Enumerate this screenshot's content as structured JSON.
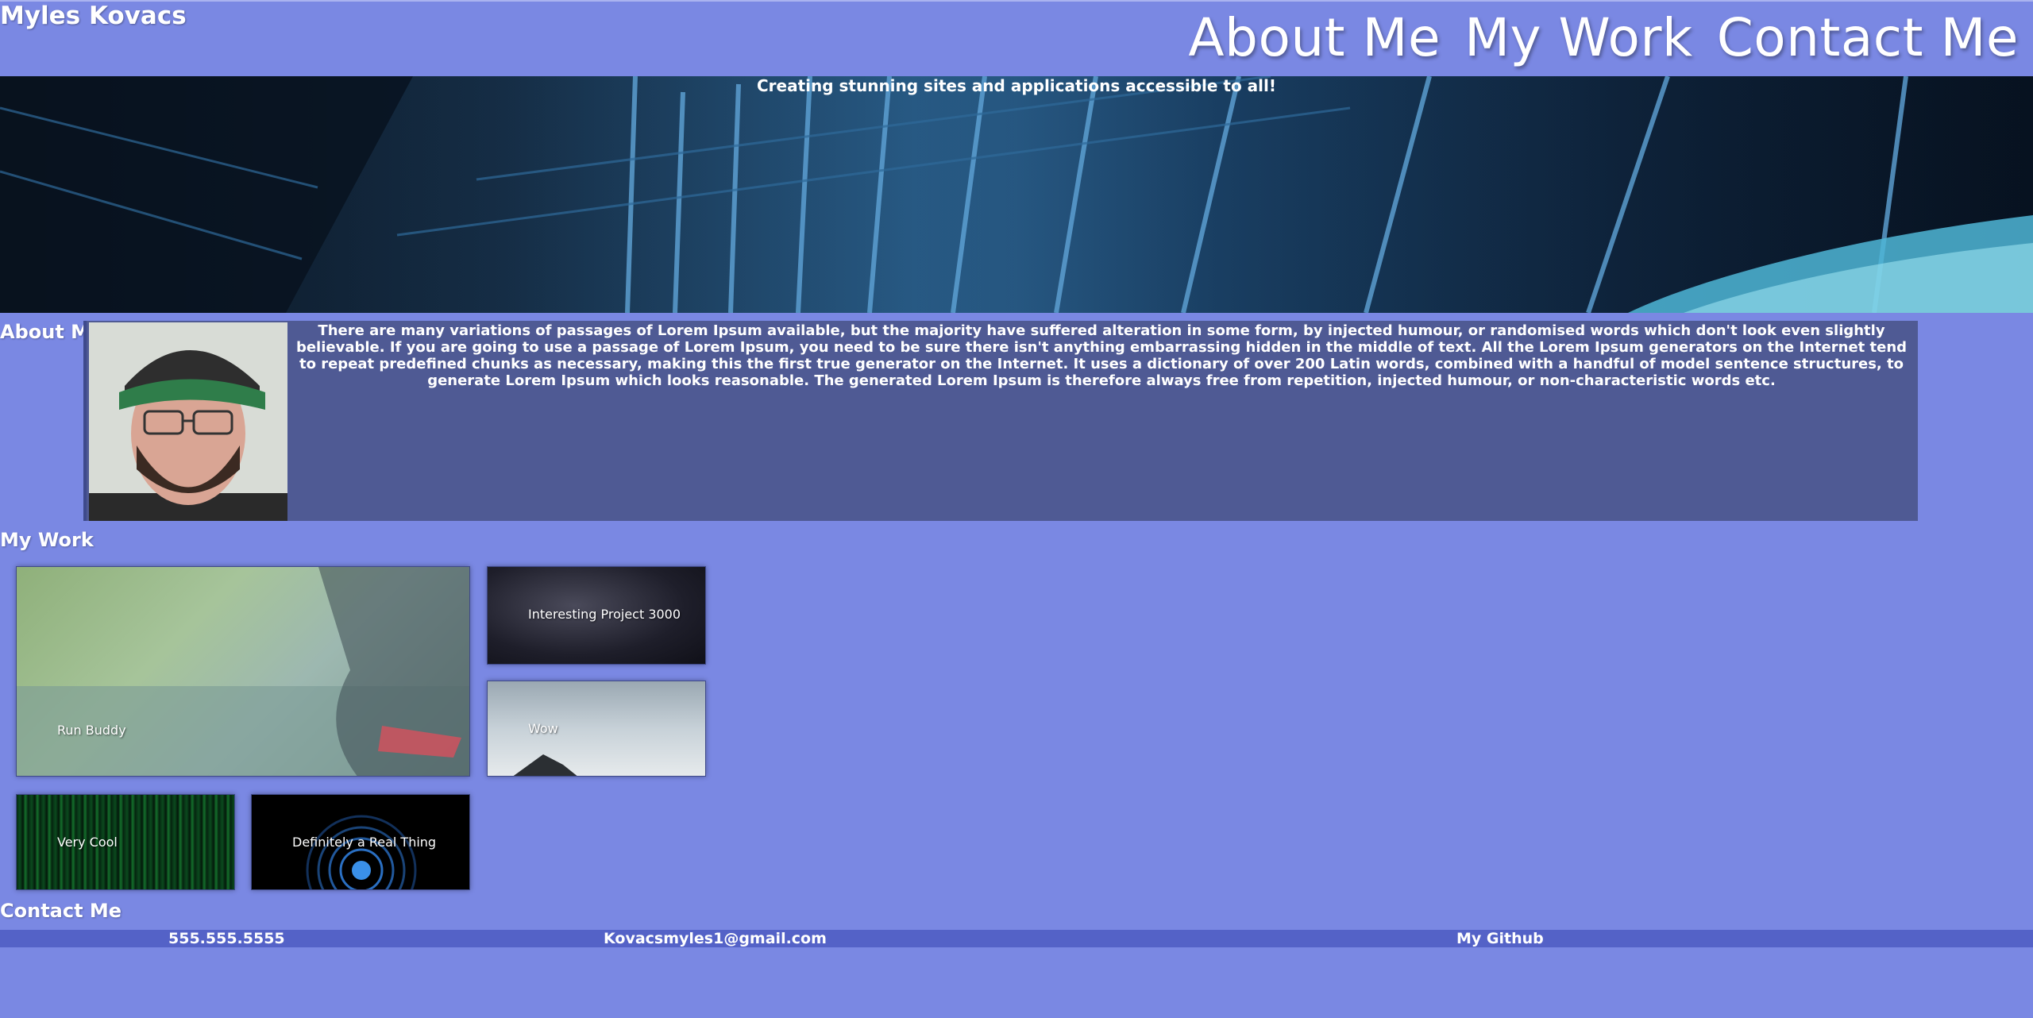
{
  "header": {
    "site_name": "Myles Kovacs",
    "nav": [
      "About Me",
      "My Work",
      "Contact Me"
    ]
  },
  "hero": {
    "tagline": "Creating stunning sites and applications accessible to all!"
  },
  "about": {
    "title": "About Me",
    "text": "There are many variations of passages of Lorem Ipsum available, but the majority have suffered alteration in some form, by injected humour, or randomised words which don't look even slightly believable. If you are going to use a passage of Lorem Ipsum, you need to be sure there isn't anything embarrassing hidden in the middle of text. All the Lorem Ipsum generators on the Internet tend to repeat predefined chunks as necessary, making this the first true generator on the Internet. It uses a dictionary of over 200 Latin words, combined with a handful of model sentence structures, to generate Lorem Ipsum which looks reasonable. The generated Lorem Ipsum is therefore always free from repetition, injected humour, or non-characteristic words etc."
  },
  "work": {
    "title": "My Work",
    "projects": [
      {
        "label": "Run Buddy"
      },
      {
        "label": "Interesting Project 3000"
      },
      {
        "label": "Wow"
      },
      {
        "label": "Very Cool"
      },
      {
        "label": "Definitely a Real Thing"
      }
    ]
  },
  "contact": {
    "title": "Contact Me",
    "phone": "555.555.5555",
    "email": "Kovacsmyles1@gmail.com",
    "github": "My Github"
  },
  "colors": {
    "page_bg": "#7a88e3",
    "about_box": "#4f5a94",
    "contact_bar": "#5462c7"
  }
}
